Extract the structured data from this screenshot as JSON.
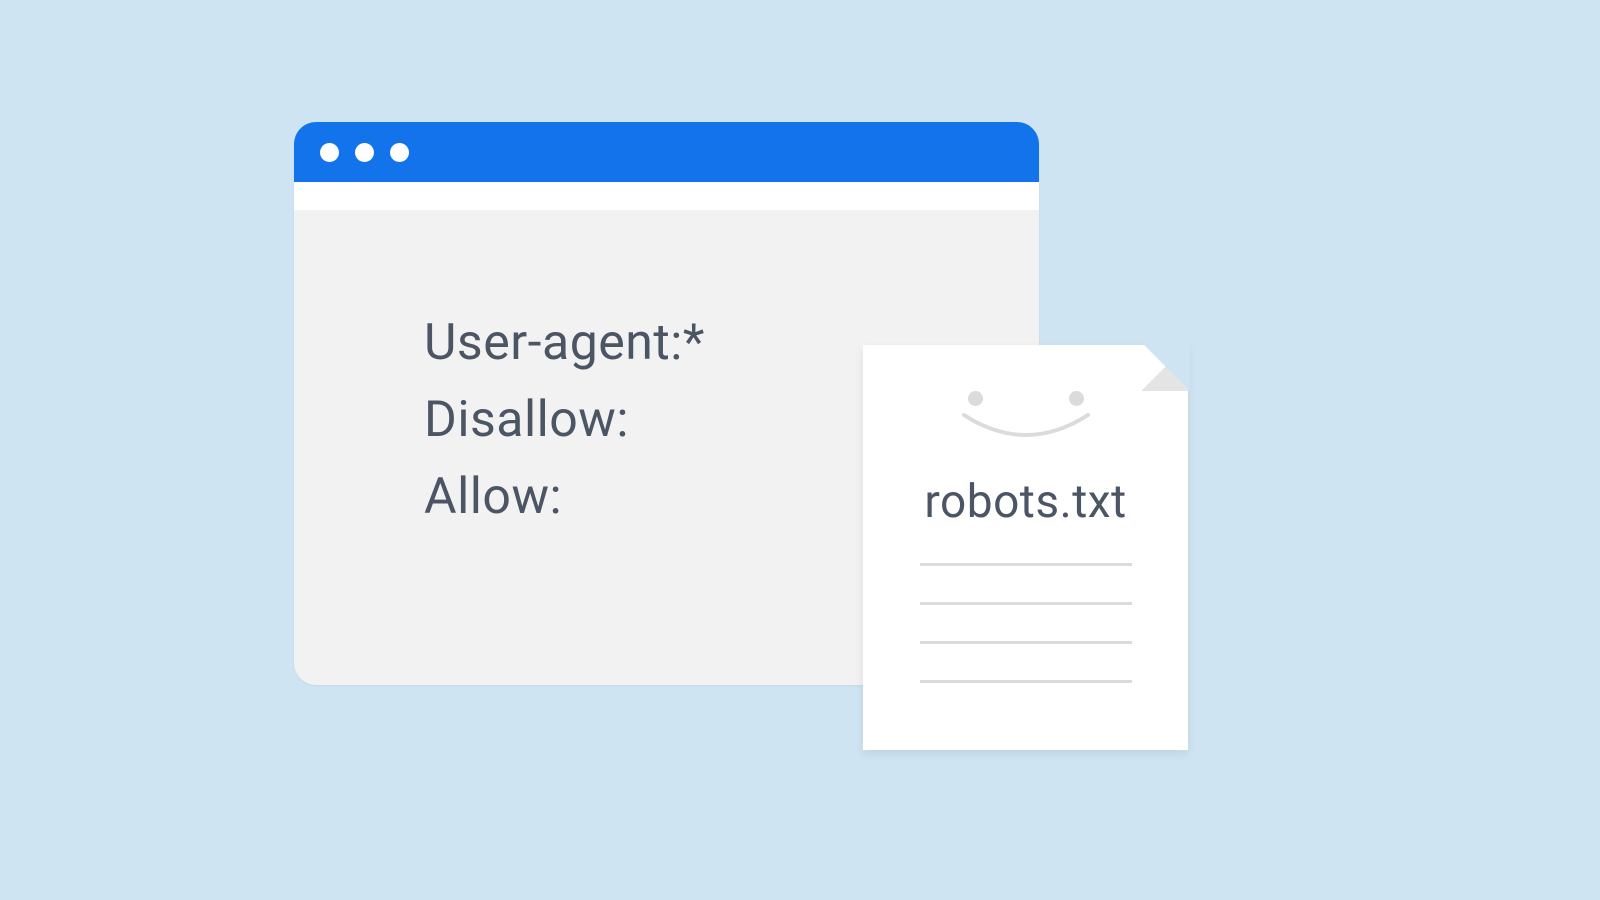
{
  "browser": {
    "lines": [
      "User-agent:*",
      "Disallow:",
      "Allow:"
    ]
  },
  "file": {
    "title": "robots.txt"
  }
}
